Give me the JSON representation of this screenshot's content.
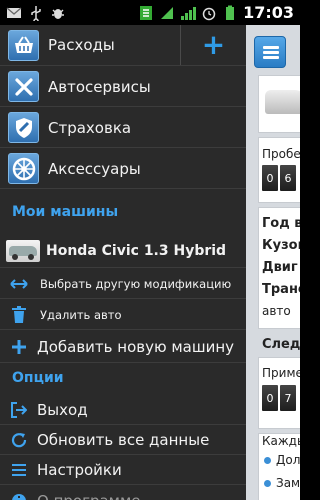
{
  "status_bar": {
    "time": "17:03"
  },
  "drawer": {
    "top_items": [
      {
        "label": "Расходы",
        "icon": "basket-icon"
      },
      {
        "label": "Автосервисы",
        "icon": "tools-icon"
      },
      {
        "label": "Страховка",
        "icon": "shield-icon"
      },
      {
        "label": "Аксессуары",
        "icon": "wheel-icon"
      }
    ],
    "my_cars_title": "Мои машины",
    "car": {
      "name": "Honda Civic 1.3 Hybrid",
      "change_mod": "Выбрать другую модификацию",
      "delete": "Удалить авто"
    },
    "add_car": "Добавить новую машину",
    "options_title": "Опции",
    "options": [
      {
        "label": "Выход",
        "icon": "exit-icon"
      },
      {
        "label": "Обновить все данные",
        "icon": "refresh-icon"
      },
      {
        "label": "Настройки",
        "icon": "settings-icon"
      },
      {
        "label": "О программе",
        "icon": "info-icon"
      }
    ]
  },
  "background": {
    "mileage_label": "Пробег",
    "mileage_digits": [
      "0",
      "6"
    ],
    "spec_labels": [
      "Год в",
      "Кузов",
      "Двиг",
      "Транс",
      "авто"
    ],
    "next_label": "Следу",
    "approx_label": "Приме",
    "approx_digits": [
      "0",
      "7"
    ],
    "each_label": "Кажды",
    "bullets": [
      "Дол",
      "Зам"
    ]
  },
  "colors": {
    "accent": "#3fa3ee",
    "drawer_bg": "#2a2a2a",
    "content_bg": "#d6dadf"
  }
}
